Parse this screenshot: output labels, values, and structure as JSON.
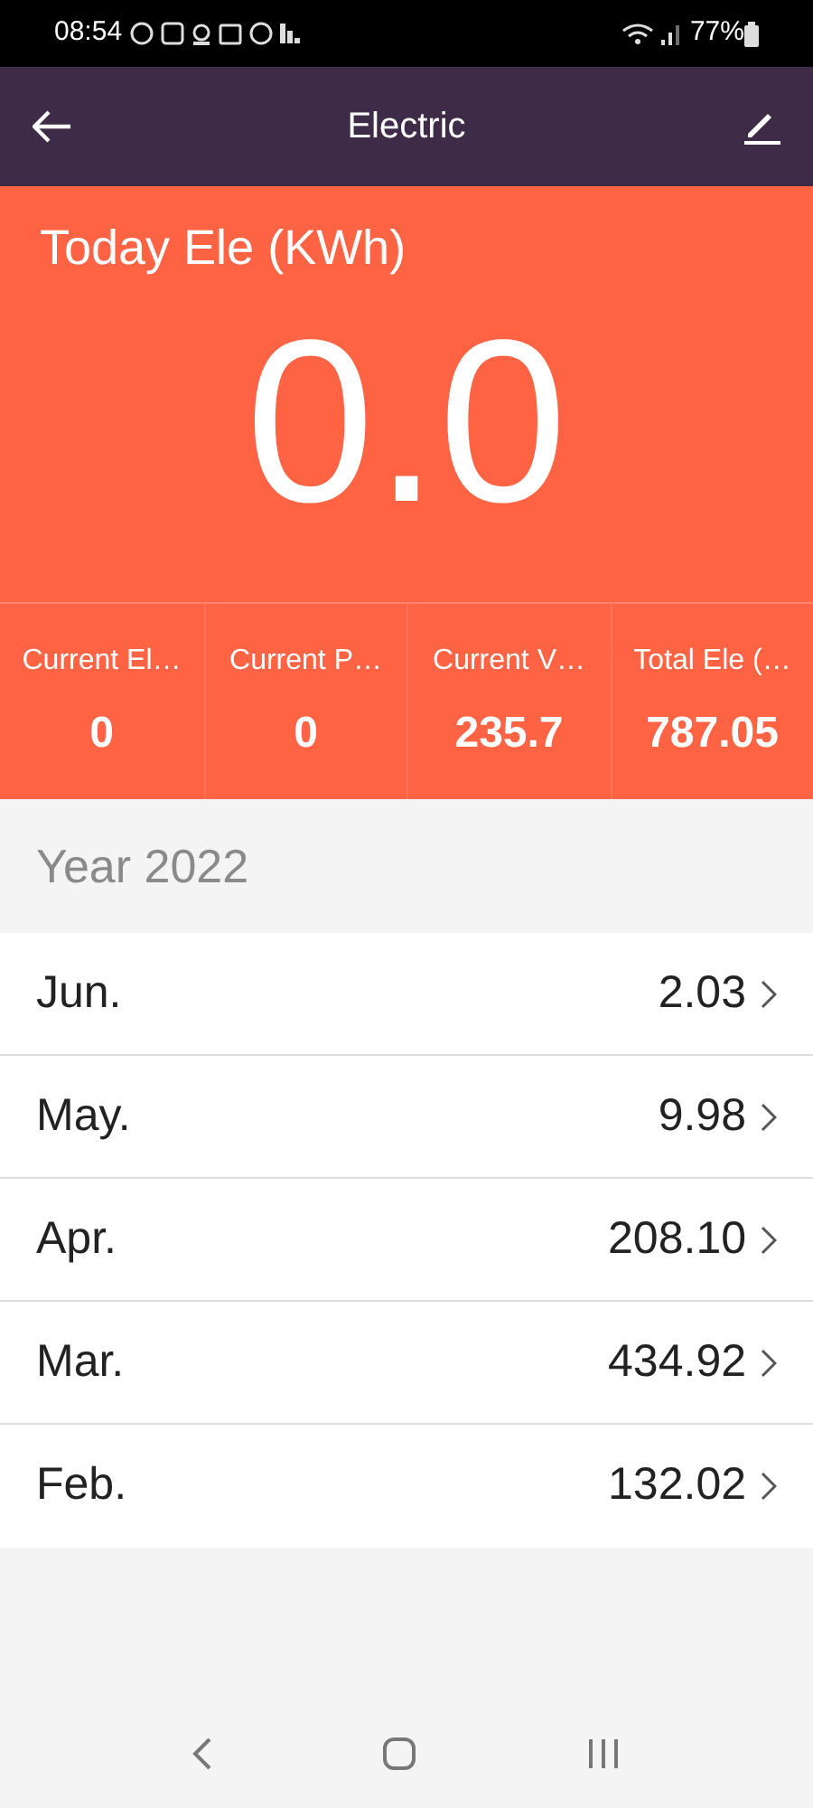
{
  "status_bar": {
    "time": "08:54",
    "battery": "77%"
  },
  "header": {
    "title": "Electric"
  },
  "today": {
    "label": "Today Ele (KWh)",
    "value": "0.0"
  },
  "stats": [
    {
      "label": "Current El…",
      "value": "0"
    },
    {
      "label": "Current P…",
      "value": "0"
    },
    {
      "label": "Current V…",
      "value": "235.7"
    },
    {
      "label": "Total Ele (…",
      "value": "787.05"
    }
  ],
  "year": {
    "title": "Year 2022"
  },
  "months": [
    {
      "name": "Jun.",
      "value": "2.03"
    },
    {
      "name": "May.",
      "value": "9.98"
    },
    {
      "name": "Apr.",
      "value": "208.10"
    },
    {
      "name": "Mar.",
      "value": "434.92"
    },
    {
      "name": "Feb.",
      "value": "132.02"
    }
  ]
}
